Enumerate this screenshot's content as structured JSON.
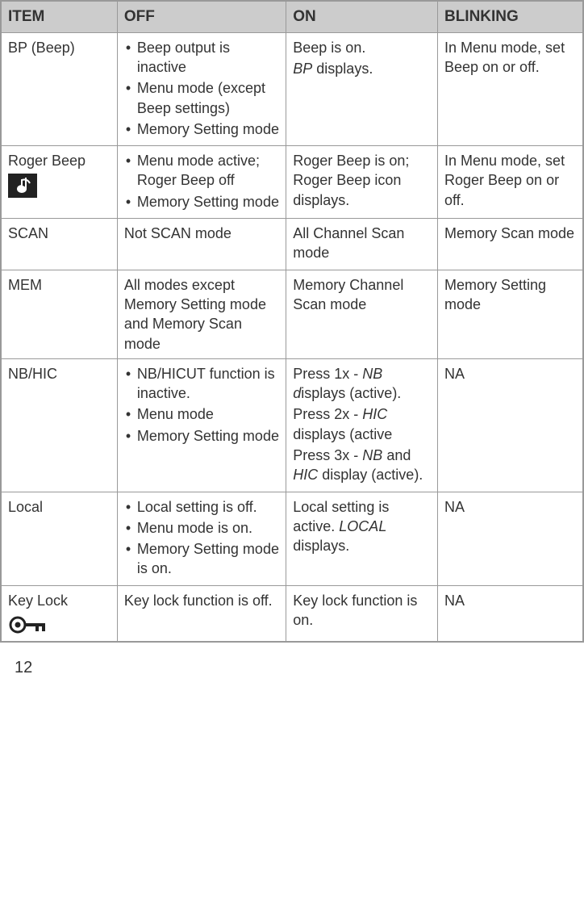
{
  "headers": {
    "item": "ITEM",
    "off": "OFF",
    "on": "ON",
    "blinking": "BLINKING"
  },
  "rows": [
    {
      "item": {
        "label": "BP (Beep)",
        "icon": null
      },
      "off_list": [
        "Beep output is inactive",
        "Menu mode (except Beep settings)",
        "Memory Setting mode"
      ],
      "on_lines": [
        {
          "pre": "",
          "text": "Beep is on."
        },
        {
          "pre": "BP",
          "text": " displays."
        }
      ],
      "blinking": "In Menu mode, set Beep on or off."
    },
    {
      "item": {
        "label": "Roger Beep",
        "icon": "note"
      },
      "off_list": [
        "Menu mode active; Roger Beep off",
        "Memory Setting mode"
      ],
      "on_lines": [
        {
          "pre": "",
          "text": "Roger Beep is on; Roger Beep icon displays."
        }
      ],
      "blinking": "In Menu mode, set Roger Beep on or off."
    },
    {
      "item": {
        "label": "SCAN",
        "icon": null
      },
      "off_text": "Not SCAN mode",
      "on_lines": [
        {
          "pre": "",
          "text": "All Channel Scan mode"
        }
      ],
      "blinking": "Memory Scan mode"
    },
    {
      "item": {
        "label": "MEM",
        "icon": null
      },
      "off_text": "All modes except Memory Setting mode and Memory Scan mode",
      "on_lines": [
        {
          "pre": "",
          "text": "Memory Channel Scan mode"
        }
      ],
      "blinking": "Memory Setting mode"
    },
    {
      "item": {
        "label": "NB/HIC",
        "icon": null
      },
      "off_list": [
        "NB/HICUT function is inactive.",
        "Menu mode",
        "Memory Setting mode"
      ],
      "on_nbhic": {
        "l1a": "Press 1x - ",
        "l1b": "NB d",
        "l1c": "isplays (active).",
        "l2a": "Press 2x - ",
        "l2b": "HIC",
        "l2c": " displays (active",
        "l3a": "Press 3x - ",
        "l3b": "NB",
        "l3c": " and ",
        "l3d": "HIC",
        "l3e": " display (active)."
      },
      "blinking": "NA"
    },
    {
      "item": {
        "label": "Local",
        "icon": null
      },
      "off_list": [
        "Local setting is off.",
        "Menu mode is on.",
        "Memory Setting mode is on."
      ],
      "on_local": {
        "a": "Local setting is active. ",
        "b": "LOCAL",
        "c": " displays."
      },
      "blinking": "NA"
    },
    {
      "item": {
        "label": "Key Lock",
        "icon": "key"
      },
      "off_text": "Key lock function is off.",
      "on_lines": [
        {
          "pre": "",
          "text": "Key lock function is on."
        }
      ],
      "blinking": "NA"
    }
  ],
  "page_number": "12"
}
